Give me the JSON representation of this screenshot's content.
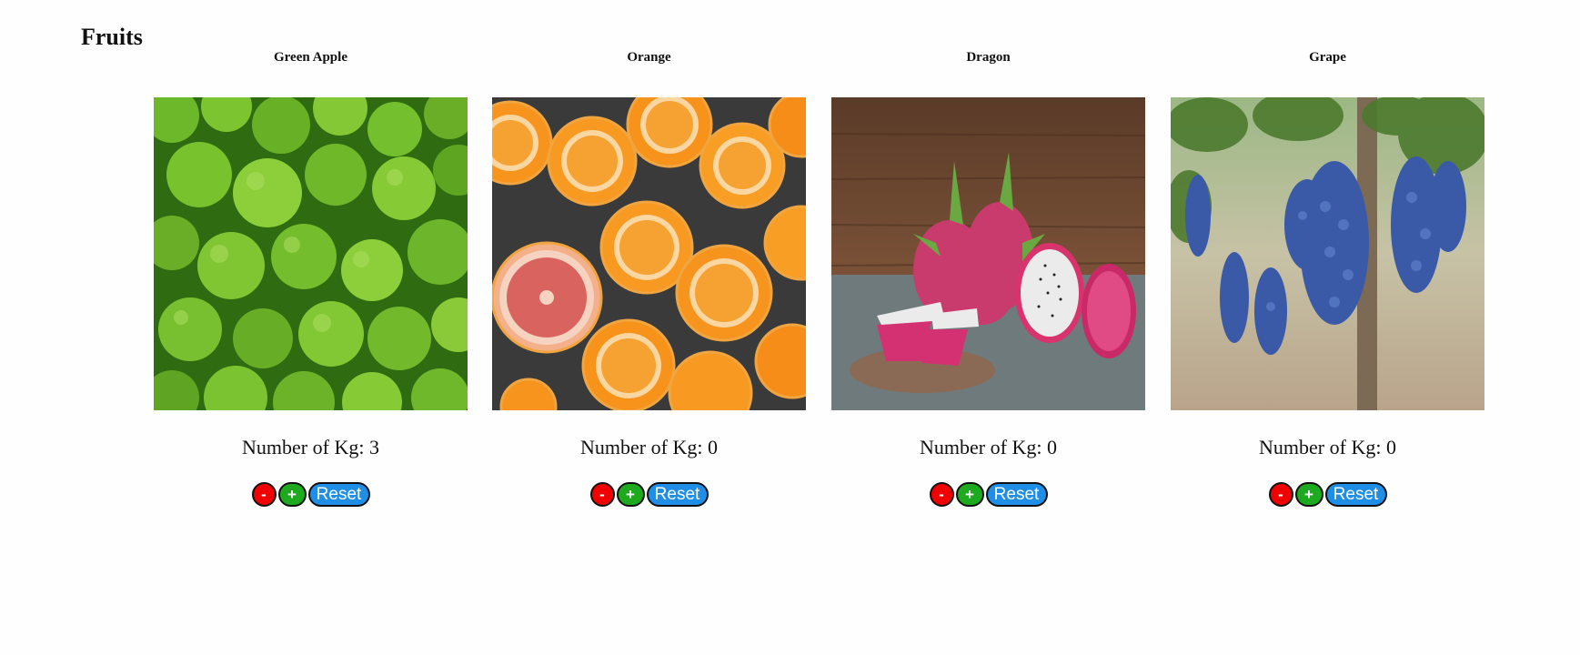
{
  "page": {
    "title": "Fruits"
  },
  "fruits": [
    {
      "name": "Green Apple",
      "kg_label": "Number of Kg: 3",
      "kg_value": 3,
      "image_icon": "green-apple-photo",
      "minus_label": "-",
      "plus_label": "+",
      "reset_label": "Reset"
    },
    {
      "name": "Orange",
      "kg_label": "Number of Kg: 0",
      "kg_value": 0,
      "image_icon": "orange-photo",
      "minus_label": "-",
      "plus_label": "+",
      "reset_label": "Reset"
    },
    {
      "name": "Dragon",
      "kg_label": "Number of Kg: 0",
      "kg_value": 0,
      "image_icon": "dragon-fruit-photo",
      "minus_label": "-",
      "plus_label": "+",
      "reset_label": "Reset"
    },
    {
      "name": "Grape",
      "kg_label": "Number of Kg: 0",
      "kg_value": 0,
      "image_icon": "grape-photo",
      "minus_label": "-",
      "plus_label": "+",
      "reset_label": "Reset"
    }
  ],
  "colors": {
    "minus_button": "#f00000",
    "plus_button": "#1eaa1e",
    "reset_button": "#1f8ee6"
  }
}
